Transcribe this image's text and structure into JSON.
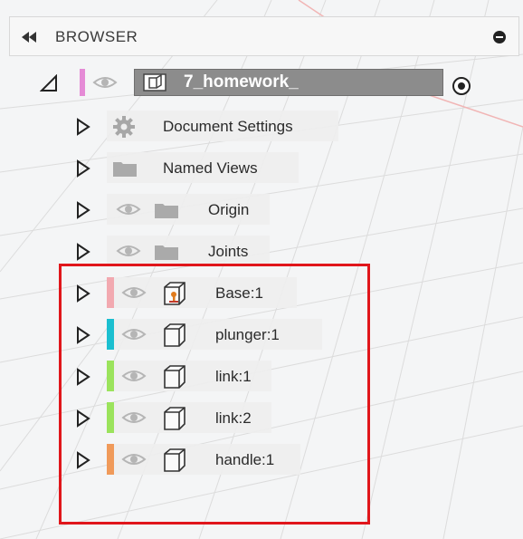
{
  "browser": {
    "title": "BROWSER"
  },
  "root": {
    "name": "7_homework_",
    "color": "#e58bd6"
  },
  "items": [
    {
      "label": "Document Settings",
      "icon": "gear-icon"
    },
    {
      "label": "Named Views",
      "icon": "folder-icon"
    },
    {
      "label": "Origin",
      "icon": "folder-icon"
    },
    {
      "label": "Joints",
      "icon": "folder-icon"
    }
  ],
  "components": [
    {
      "label": "Base:1",
      "color": "#f2a9b0",
      "icon": "grounded-component-icon"
    },
    {
      "label": "plunger:1",
      "color": "#1bbfd0",
      "icon": "component-icon"
    },
    {
      "label": "link:1",
      "color": "#9be35c",
      "icon": "component-icon"
    },
    {
      "label": "link:2",
      "color": "#9be35c",
      "icon": "component-icon"
    },
    {
      "label": "handle:1",
      "color": "#f09a5a",
      "icon": "component-icon"
    }
  ],
  "highlight_color": "#e0161b"
}
